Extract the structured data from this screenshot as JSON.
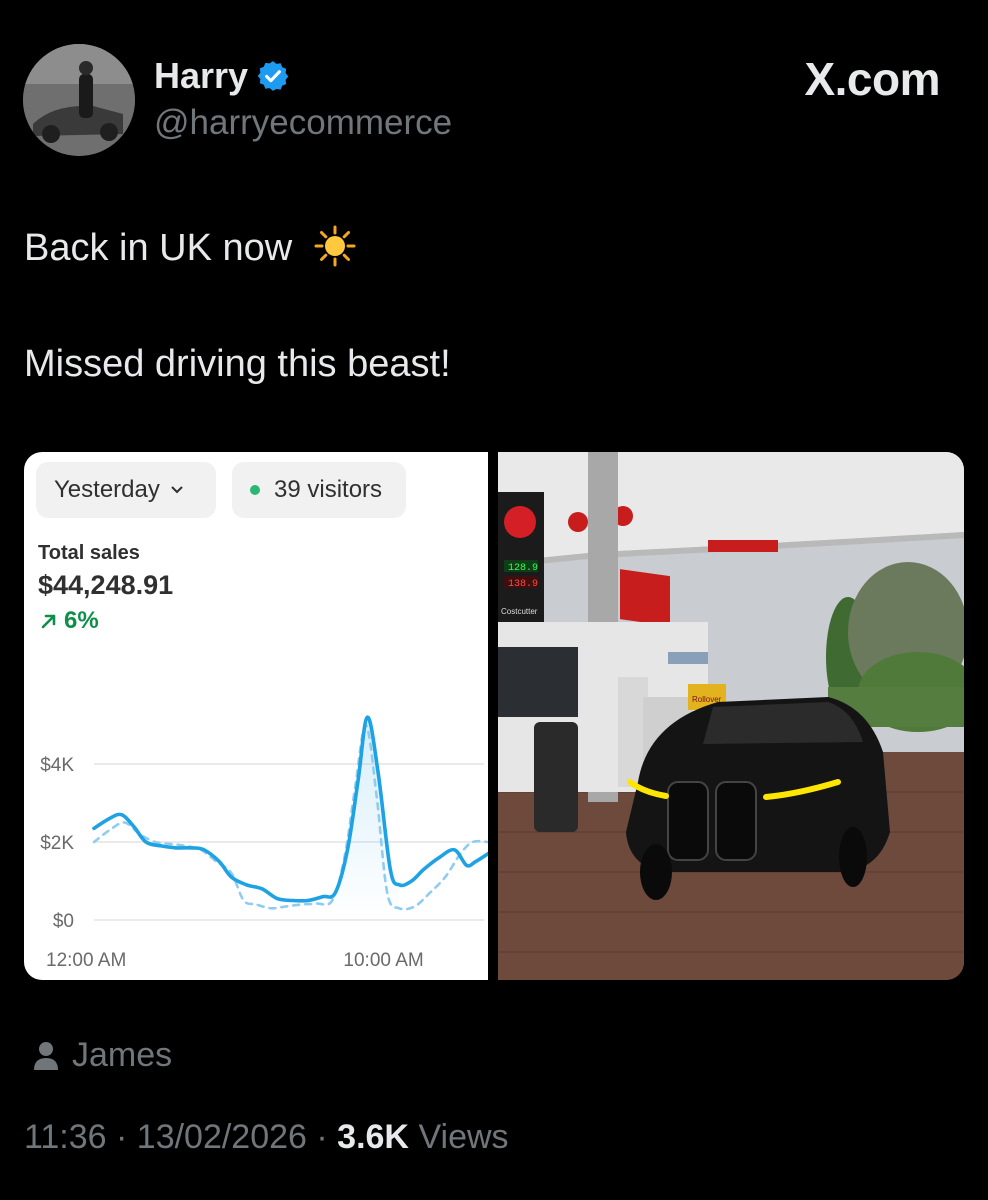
{
  "author": {
    "name": "Harry",
    "handle": "@harryecommerce"
  },
  "brand": "X.com",
  "tweet": {
    "line1": "Back in UK now",
    "line2": "Missed driving this beast!"
  },
  "media": {
    "dashboard": {
      "date_filter": "Yesterday",
      "visitors": "39 visitors",
      "total_sales_label": "Total sales",
      "total_sales_value": "$44,248.91",
      "change": "6%",
      "accent_color": "#1ea2e3",
      "positive_color": "#0d8f4a",
      "chart_data": {
        "type": "line",
        "title": "",
        "xlabel": "",
        "ylabel": "",
        "ylim": [
          0,
          5500
        ],
        "y_ticks": [
          "$0",
          "$2K",
          "$4K"
        ],
        "y_tick_values": [
          0,
          2000,
          4000
        ],
        "x_tick_labels": [
          "12:00 AM",
          "10:00 AM"
        ],
        "x_tick_hours": [
          0,
          10
        ],
        "grid": true,
        "legend": "none",
        "series": [
          {
            "style": "solid",
            "points": [
              [
                0,
                2350
              ],
              [
                0.5,
                2600
              ],
              [
                0.9,
                2700
              ],
              [
                1.3,
                2400
              ],
              [
                1.7,
                2000
              ],
              [
                2.2,
                1900
              ],
              [
                2.7,
                1850
              ],
              [
                3.2,
                1850
              ],
              [
                3.6,
                1800
              ],
              [
                4.1,
                1500
              ],
              [
                4.5,
                1100
              ],
              [
                5.0,
                900
              ],
              [
                5.5,
                800
              ],
              [
                6.0,
                550
              ],
              [
                6.5,
                500
              ],
              [
                7.0,
                500
              ],
              [
                7.5,
                600
              ],
              [
                7.9,
                700
              ],
              [
                8.3,
                1800
              ],
              [
                8.65,
                3600
              ],
              [
                8.95,
                5200
              ],
              [
                9.3,
                3800
              ],
              [
                9.7,
                1300
              ],
              [
                10.0,
                900
              ],
              [
                10.4,
                1000
              ],
              [
                10.8,
                1300
              ],
              [
                11.3,
                1600
              ],
              [
                11.8,
                1800
              ],
              [
                12.2,
                1400
              ],
              [
                12.5,
                1500
              ],
              [
                12.9,
                1700
              ]
            ]
          },
          {
            "style": "dashed",
            "points": [
              [
                0,
                2000
              ],
              [
                0.5,
                2300
              ],
              [
                1.0,
                2500
              ],
              [
                1.5,
                2200
              ],
              [
                2.0,
                2000
              ],
              [
                2.5,
                1950
              ],
              [
                3.0,
                1900
              ],
              [
                3.5,
                1800
              ],
              [
                4.0,
                1500
              ],
              [
                4.5,
                1200
              ],
              [
                4.9,
                500
              ],
              [
                5.3,
                400
              ],
              [
                5.8,
                300
              ],
              [
                6.3,
                350
              ],
              [
                6.8,
                400
              ],
              [
                7.3,
                420
              ],
              [
                7.8,
                500
              ],
              [
                8.2,
                1600
              ],
              [
                8.55,
                3400
              ],
              [
                8.9,
                5000
              ],
              [
                9.25,
                3200
              ],
              [
                9.6,
                700
              ],
              [
                10.0,
                300
              ],
              [
                10.5,
                350
              ],
              [
                11.0,
                700
              ],
              [
                11.5,
                1100
              ],
              [
                12.0,
                1700
              ],
              [
                12.4,
                2000
              ],
              [
                12.9,
                2000
              ]
            ]
          }
        ]
      }
    },
    "photo_signage": {
      "price_unleaded": "128.9",
      "price_diesel": "138.9",
      "store": "Costcutter",
      "rollover": "Rollover"
    }
  },
  "footer": {
    "user": "James",
    "time": "11:36",
    "date": "13/02/2026",
    "views_count": "3.6K",
    "views_label": "Views"
  }
}
